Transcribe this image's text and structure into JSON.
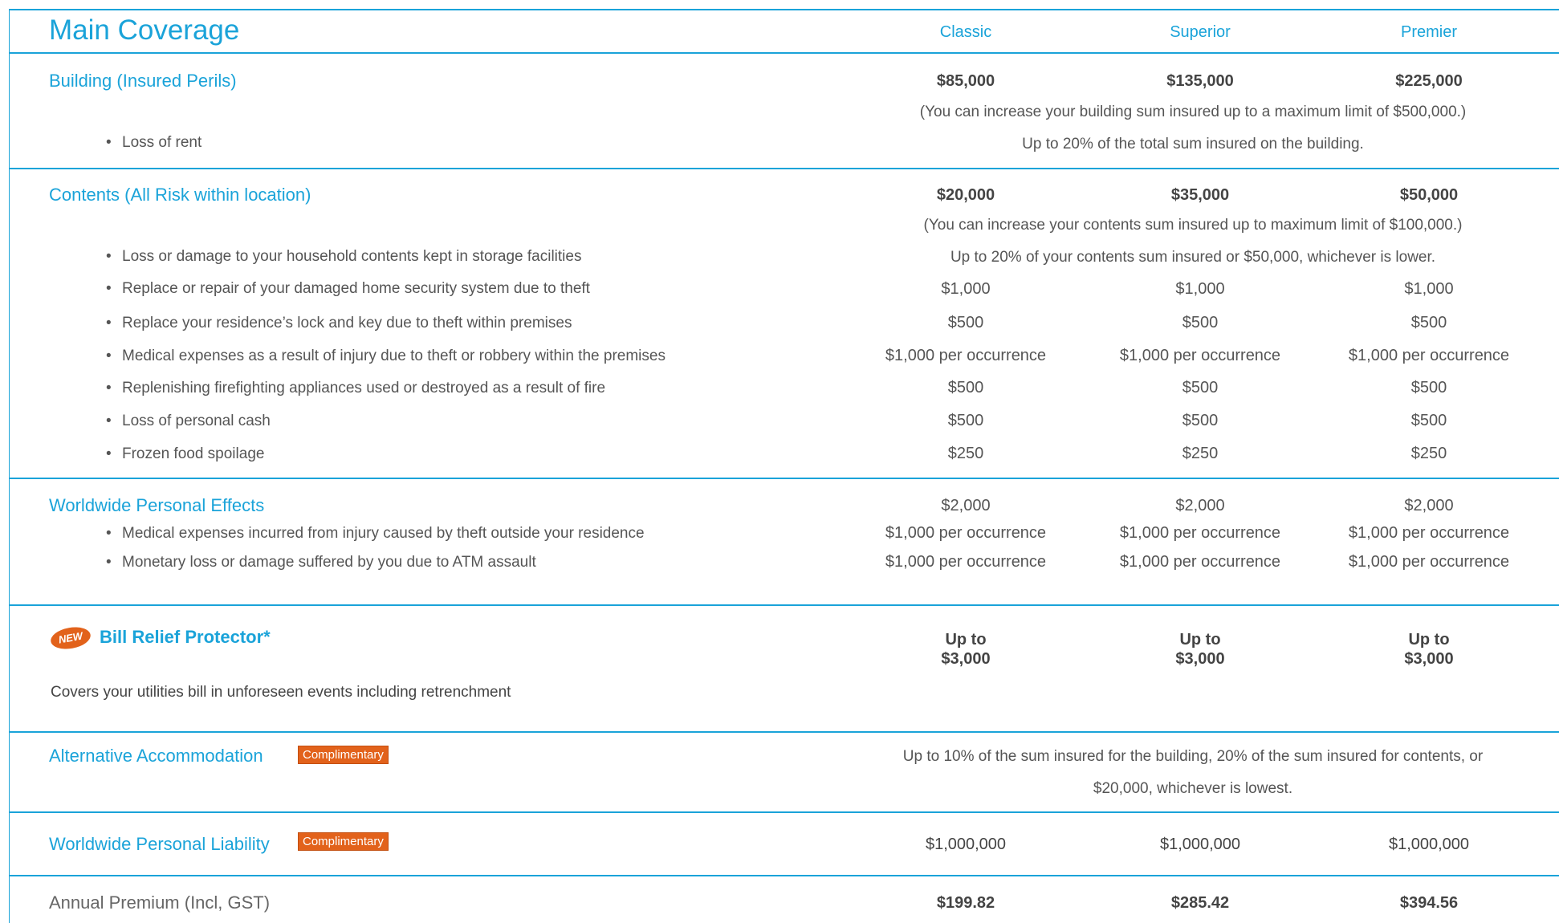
{
  "header": {
    "title": "Main Coverage",
    "columns": [
      "Classic",
      "Superior",
      "Premier"
    ]
  },
  "building": {
    "title": "Building (Insured Perils)",
    "values": [
      "$85,000",
      "$135,000",
      "$225,000"
    ],
    "note": "(You can increase your building sum insured up to a maximum limit of $500,000.)",
    "loss_of_rent": {
      "label": "Loss of rent",
      "value": "Up to 20% of the total sum insured on the building."
    }
  },
  "contents": {
    "title": "Contents (All Risk within location)",
    "values": [
      "$20,000",
      "$35,000",
      "$50,000"
    ],
    "note": "(You can increase your contents sum insured up to maximum limit of $100,000.)",
    "storage": {
      "label": "Loss or damage to your household contents kept in storage facilities",
      "value": "Up to 20% of your contents sum insured or $50,000, whichever is lower."
    },
    "items": [
      {
        "label": "Replace or repair of your damaged home security system due to theft",
        "values": [
          "$1,000",
          "$1,000",
          "$1,000"
        ]
      },
      {
        "label": "Replace your residence’s lock and key due to theft within premises",
        "values": [
          "$500",
          "$500",
          "$500"
        ]
      },
      {
        "label": "Medical expenses as a result of injury due to theft or robbery within the premises",
        "values": [
          "$1,000 per occurrence",
          "$1,000 per occurrence",
          "$1,000 per occurrence"
        ]
      },
      {
        "label": "Replenishing firefighting appliances used or destroyed as a result of fire",
        "values": [
          "$500",
          "$500",
          "$500"
        ]
      },
      {
        "label": "Loss of personal cash",
        "values": [
          "$500",
          "$500",
          "$500"
        ]
      },
      {
        "label": "Frozen food spoilage",
        "values": [
          "$250",
          "$250",
          "$250"
        ]
      }
    ]
  },
  "worldwide_effects": {
    "title": "Worldwide Personal Effects",
    "values": [
      "$2,000",
      "$2,000",
      "$2,000"
    ],
    "items": [
      {
        "label": "Medical expenses incurred from injury caused by theft outside your residence",
        "values": [
          "$1,000 per occurrence",
          "$1,000 per occurrence",
          "$1,000 per occurrence"
        ]
      },
      {
        "label": "Monetary loss or damage suffered by you due to ATM assault",
        "values": [
          "$1,000 per occurrence",
          "$1,000 per occurrence",
          "$1,000 per occurrence"
        ]
      }
    ]
  },
  "bill_relief": {
    "badge": "NEW",
    "title": "Bill Relief Protector*",
    "description": "Covers your utilities bill in unforeseen events including retrenchment",
    "up_to": "Up to",
    "values": [
      "$3,000",
      "$3,000",
      "$3,000"
    ]
  },
  "alt_accommodation": {
    "title": "Alternative Accommodation",
    "badge": "Complimentary",
    "value_line1": "Up to 10% of the sum insured for the building, 20% of the sum insured for contents, or",
    "value_line2": "$20,000, whichever is lowest."
  },
  "liability": {
    "title": "Worldwide Personal Liability",
    "badge": "Complimentary",
    "values": [
      "$1,000,000",
      "$1,000,000",
      "$1,000,000"
    ]
  },
  "premium": {
    "title": "Annual Premium (Incl, GST)",
    "values": [
      "$199.82",
      "$285.42",
      "$394.56"
    ]
  },
  "colors": {
    "accent": "#1aa3d9",
    "badge": "#e2621b"
  }
}
